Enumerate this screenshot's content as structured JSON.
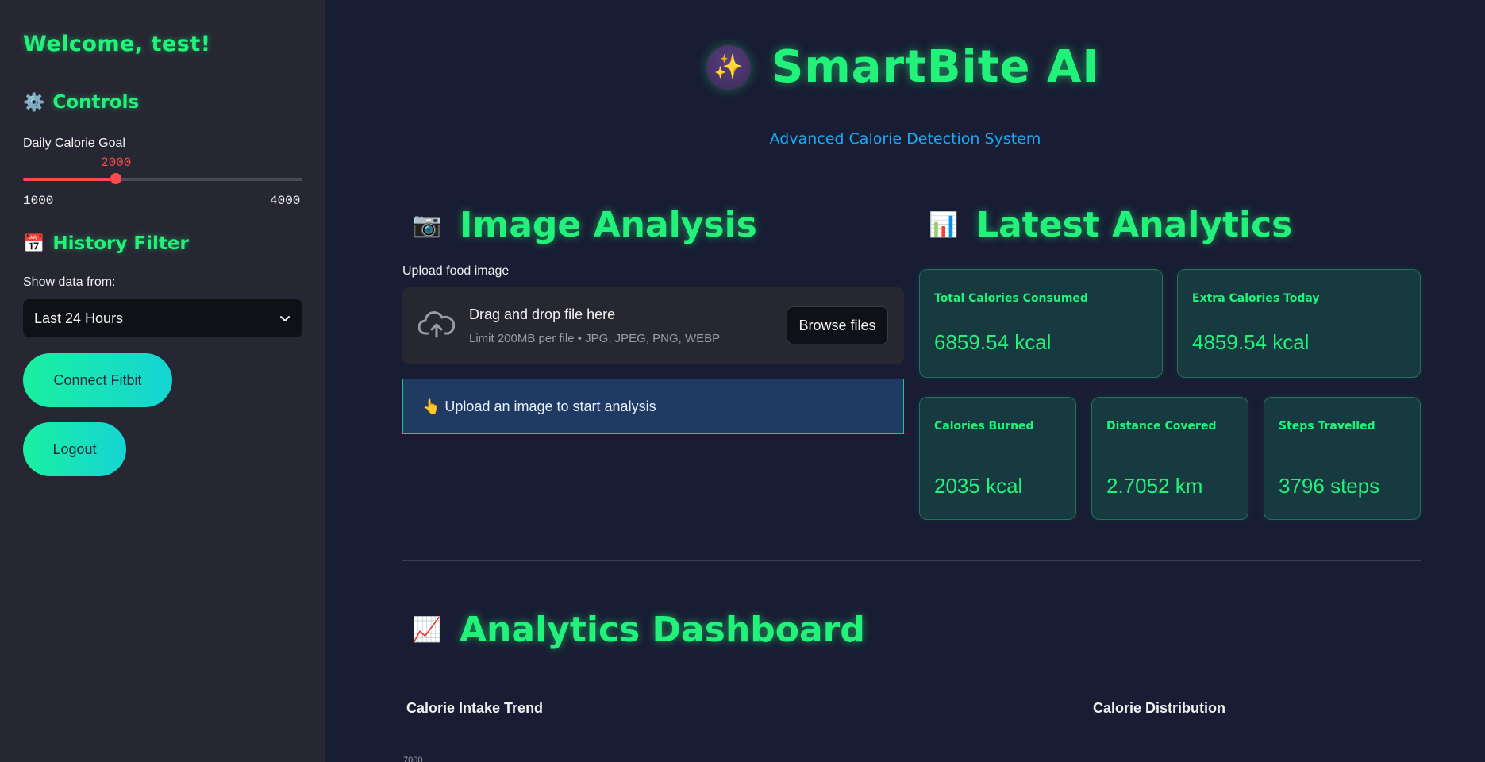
{
  "sidebar": {
    "welcome": "Welcome, test!",
    "controls_heading": "Controls",
    "controls_icon": "gear-icon",
    "calorie_goal_label": "Daily Calorie Goal",
    "calorie_goal": {
      "value": "2000",
      "min": "1000",
      "max": "4000",
      "fraction": 0.333,
      "color": "#ff4b4b"
    },
    "history_heading": "History Filter",
    "history_icon": "calendar-icon",
    "show_label": "Show data from:",
    "history_selected": "Last 24 Hours",
    "connect_fitbit": "Connect Fitbit",
    "logout": "Logout"
  },
  "header": {
    "title": "SmartBite AI",
    "title_icon": "crystal-ball-icon",
    "subtitle": "Advanced Calorie Detection System"
  },
  "image_analysis": {
    "heading": "Image Analysis",
    "icon": "camera-icon",
    "upload_label": "Upload food image",
    "dropzone_title": "Drag and drop file here",
    "dropzone_limit": "Limit 200MB per file • JPG, JPEG, PNG, WEBP",
    "browse_label": "Browse files",
    "info_icon": "👆",
    "info_text": "Upload an image to start analysis"
  },
  "latest_analytics": {
    "heading": "Latest Analytics",
    "icon": "bar-chart-icon",
    "cards": {
      "total": {
        "label": "Total Calories Consumed",
        "value": "6859.54 kcal"
      },
      "extra": {
        "label": "Extra Calories Today",
        "value": "4859.54 kcal"
      },
      "burned": {
        "label": "Calories Burned",
        "value": "2035 kcal"
      },
      "distance": {
        "label": "Distance Covered",
        "value": "2.7052 km"
      },
      "steps": {
        "label": "Steps Travelled",
        "value": "3796 steps"
      }
    }
  },
  "dashboard": {
    "heading": "Analytics Dashboard",
    "icon": "trend-chart-icon",
    "intake_title": "Calorie Intake Trend",
    "distribution_title": "Calorie Distribution",
    "first_tick": "7000"
  },
  "colors": {
    "accent_green": "#22f27a",
    "accent_blue": "#1ba9f5",
    "slider_red": "#ff4b4b"
  }
}
